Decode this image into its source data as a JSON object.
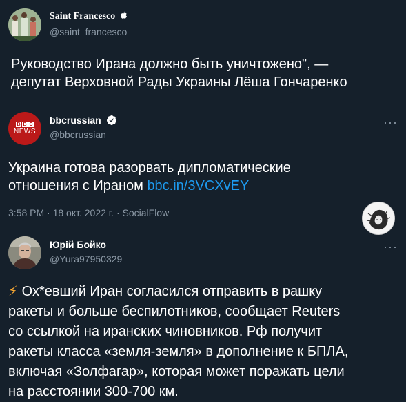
{
  "tweet1": {
    "name": "Saint Francesco",
    "handle": "@saint_francesco",
    "text_line1": "Руководство Ирана должно быть уничтожено\", —",
    "text_line2": "депутат Верховной Рады Украины Лёша Гончаренко"
  },
  "tweet2": {
    "name": "bbcrussian",
    "handle": "@bbcrussian",
    "avatar_text_top": "BBC",
    "avatar_text_bottom": "NEWS",
    "text_line1": "Украина готова разорвать дипломатические",
    "text_line2_prefix": "отношения с Ираном ",
    "link": "bbc.in/3VCXvEY",
    "time": "3:58 PM · 18 окт. 2022 г. · SocialFlow",
    "more": "···"
  },
  "tweet3": {
    "name": "Юрій Бойко",
    "handle": "@Yura97950329",
    "emoji": "⚡",
    "lines": [
      "Ох*евший Иран согласился отправить в рашку",
      "ракеты и больше беспилотников, сообщает Reuters",
      "со ссылкой на иранских чиновников. Рф получит",
      "ракеты класса «земля-земля» в дополнение к БПЛА,",
      "включая «Золфагар», которая может поражать цели",
      "на расстоянии 300-700 км."
    ]
  },
  "colors": {
    "background": "#15202b",
    "secondary_text": "#8b98a5",
    "link": "#1d9bf0",
    "verified": "#ffffff",
    "bbc_red": "#bb1919"
  }
}
